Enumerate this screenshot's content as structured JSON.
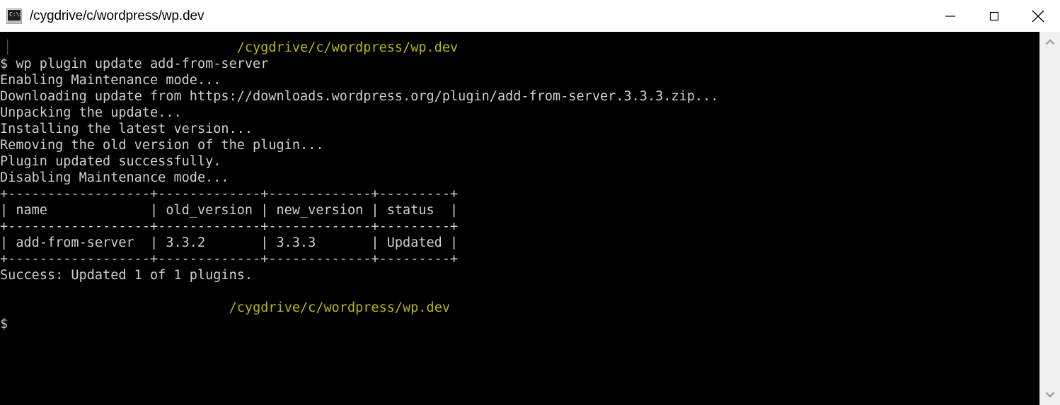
{
  "window": {
    "title": "/cygdrive/c/wordpress/wp.dev",
    "icon": "terminal-icon",
    "icon_prompt_glyph": "C:\\>",
    "controls": {
      "minimize_label": "Minimize",
      "maximize_label": "Maximize",
      "close_label": "Close"
    }
  },
  "terminal": {
    "background_color": "#000000",
    "foreground_color": "#cfcfcf",
    "prompt_path_color": "#b8b800",
    "lines": [
      {
        "id": "line-00",
        "segments": [
          {
            "color": "green-cursor",
            "text": "▕"
          },
          {
            "color": "white",
            "text": "                             "
          },
          {
            "color": "yellow",
            "text": "/cygdrive/c/wordpress/wp.dev"
          }
        ]
      },
      {
        "id": "line-01",
        "segments": [
          {
            "color": "white",
            "text": "$ wp plugin update add-from-server"
          }
        ]
      },
      {
        "id": "line-02",
        "segments": [
          {
            "color": "white",
            "text": "Enabling Maintenance mode..."
          }
        ]
      },
      {
        "id": "line-03",
        "segments": [
          {
            "color": "white",
            "text": "Downloading update from https://downloads.wordpress.org/plugin/add-from-server.3.3.3.zip..."
          }
        ]
      },
      {
        "id": "line-04",
        "segments": [
          {
            "color": "white",
            "text": "Unpacking the update..."
          }
        ]
      },
      {
        "id": "line-05",
        "segments": [
          {
            "color": "white",
            "text": "Installing the latest version..."
          }
        ]
      },
      {
        "id": "line-06",
        "segments": [
          {
            "color": "white",
            "text": "Removing the old version of the plugin..."
          }
        ]
      },
      {
        "id": "line-07",
        "segments": [
          {
            "color": "white",
            "text": "Plugin updated successfully."
          }
        ]
      },
      {
        "id": "line-08",
        "segments": [
          {
            "color": "white",
            "text": "Disabling Maintenance mode..."
          }
        ]
      },
      {
        "id": "line-09",
        "segments": [
          {
            "color": "white",
            "text": "+------------------+-------------+-------------+---------+"
          }
        ]
      },
      {
        "id": "line-10",
        "segments": [
          {
            "color": "white",
            "text": "| name             | old_version | new_version | status  |"
          }
        ]
      },
      {
        "id": "line-11",
        "segments": [
          {
            "color": "white",
            "text": "+------------------+-------------+-------------+---------+"
          }
        ]
      },
      {
        "id": "line-12",
        "segments": [
          {
            "color": "white",
            "text": "| add-from-server  | 3.3.2       | 3.3.3       | Updated |"
          }
        ]
      },
      {
        "id": "line-13",
        "segments": [
          {
            "color": "white",
            "text": "+------------------+-------------+-------------+---------+"
          }
        ]
      },
      {
        "id": "line-14",
        "segments": [
          {
            "color": "white",
            "text": "Success: Updated 1 of 1 plugins."
          }
        ]
      },
      {
        "id": "line-15",
        "segments": [
          {
            "color": "white",
            "text": ""
          }
        ]
      },
      {
        "id": "line-16",
        "segments": [
          {
            "color": "white",
            "text": "                             "
          },
          {
            "color": "yellow",
            "text": "/cygdrive/c/wordpress/wp.dev"
          }
        ]
      },
      {
        "id": "line-17",
        "segments": [
          {
            "color": "white",
            "text": "$"
          }
        ]
      }
    ],
    "command": "wp plugin update add-from-server",
    "prompt_symbol": "$",
    "result_table": {
      "headers": [
        "name",
        "old_version",
        "new_version",
        "status"
      ],
      "rows": [
        [
          "add-from-server",
          "3.3.2",
          "3.3.3",
          "Updated"
        ]
      ]
    },
    "status_message": "Success: Updated 1 of 1 plugins.",
    "download_url": "https://downloads.wordpress.org/plugin/add-from-server.3.3.3.zip"
  },
  "scrollbar": {
    "up_arrow": "chevron-up-icon",
    "down_arrow": "chevron-down-icon",
    "thumb_position": "full"
  }
}
